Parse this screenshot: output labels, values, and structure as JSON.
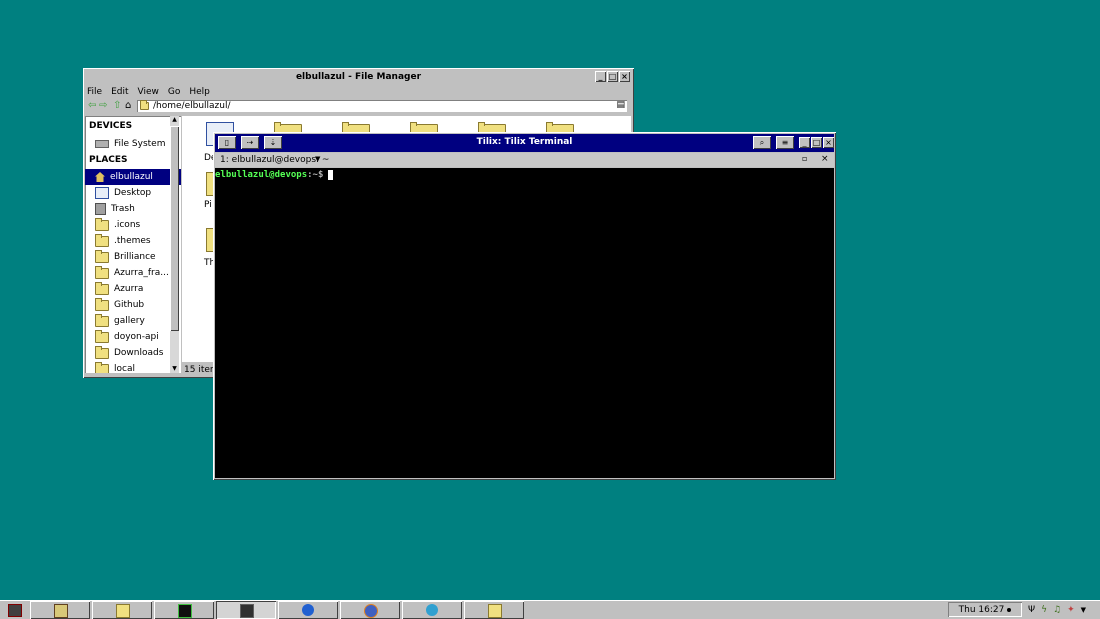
{
  "file_manager": {
    "title": "elbullazul - File Manager",
    "menu": [
      "File",
      "Edit",
      "View",
      "Go",
      "Help"
    ],
    "location": "/home/elbullazul/",
    "sidebar": {
      "devices_header": "DEVICES",
      "devices": [
        {
          "label": "File System",
          "icon": "drive-icon"
        }
      ],
      "places_header": "PLACES",
      "places": [
        {
          "label": "elbullazul",
          "icon": "home-icon"
        },
        {
          "label": "Desktop",
          "icon": "desktop-icon"
        },
        {
          "label": "Trash",
          "icon": "trash-icon"
        },
        {
          "label": ".icons",
          "icon": "folder-icon"
        },
        {
          "label": ".themes",
          "icon": "folder-icon"
        },
        {
          "label": "Brilliance",
          "icon": "folder-icon"
        },
        {
          "label": "Azurra_fra...",
          "icon": "folder-icon"
        },
        {
          "label": "Azurra",
          "icon": "folder-icon"
        },
        {
          "label": "Github",
          "icon": "folder-icon"
        },
        {
          "label": "gallery",
          "icon": "folder-icon"
        },
        {
          "label": "doyon-api",
          "icon": "folder-icon"
        },
        {
          "label": "Downloads",
          "icon": "folder-icon"
        },
        {
          "label": "local",
          "icon": "folder-icon"
        }
      ]
    },
    "content_labels": [
      "De",
      "Pi",
      "Th"
    ],
    "status": "15 item"
  },
  "terminal": {
    "title": "Tilix: Tilix Terminal",
    "session_tab": "1: elbullazul@devops: ~",
    "prompt_user": "elbullazul@devops",
    "prompt_path": ":~$",
    "colors": {
      "prompt": "#55ff55",
      "background": "#000000",
      "titlebar": "#000080"
    }
  },
  "taskbar": {
    "clock": "Thu 16:27",
    "items": [
      "start-icon",
      "xfce-icon",
      "file-manager-icon",
      "pycharm-icon",
      "terminal-icon",
      "power-icon",
      "firefox-icon",
      "media-icon",
      "image-viewer-icon"
    ]
  }
}
